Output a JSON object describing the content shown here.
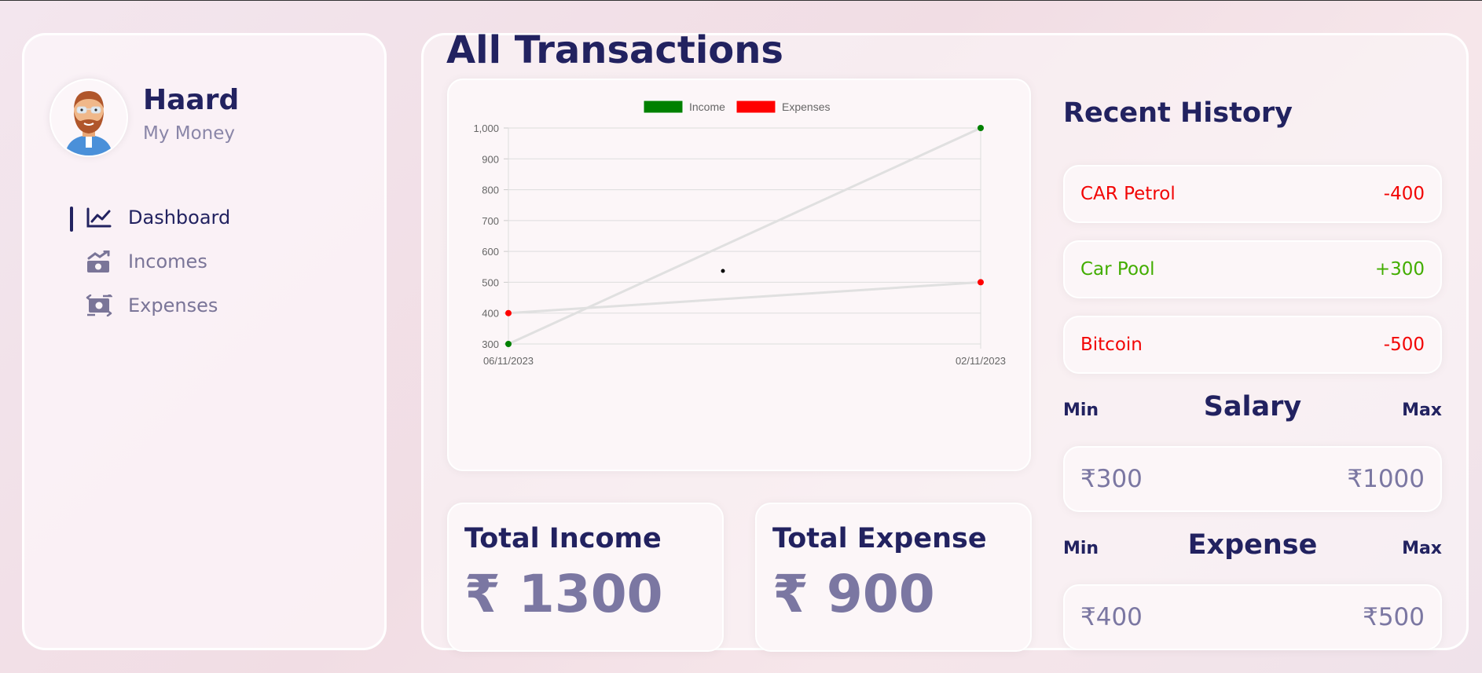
{
  "user": {
    "name": "Haard",
    "subtitle": "My Money"
  },
  "menu": [
    {
      "label": "Dashboard",
      "icon": "chart-line-icon",
      "active": true
    },
    {
      "label": "Incomes",
      "icon": "money-trend-icon",
      "active": false
    },
    {
      "label": "Expenses",
      "icon": "money-exchange-icon",
      "active": false
    }
  ],
  "main": {
    "title": "All Transactions",
    "total_income": {
      "label": "Total Income",
      "value": "₹ 1300"
    },
    "total_expense": {
      "label": "Total Expense",
      "value": "₹ 900"
    }
  },
  "chart_data": {
    "type": "line",
    "categories": [
      "06/11/2023",
      "02/11/2023"
    ],
    "series": [
      {
        "name": "Income",
        "values": [
          300,
          1000
        ],
        "color": "#008000"
      },
      {
        "name": "Expenses",
        "values": [
          400,
          500
        ],
        "color": "#ff0000"
      }
    ],
    "ylim": [
      300,
      1000
    ],
    "yticks": [
      "1,000",
      "900",
      "800",
      "700",
      "600",
      "500",
      "400",
      "300"
    ],
    "grid": true,
    "legend": "top-center"
  },
  "history": {
    "title": "Recent History",
    "items": [
      {
        "name": "CAR Petrol",
        "amount": "-400",
        "type": "expense",
        "color": "#f20505"
      },
      {
        "name": "Car Pool",
        "amount": "+300",
        "type": "income",
        "color": "#42ad00"
      },
      {
        "name": "Bitcoin",
        "amount": "-500",
        "type": "expense",
        "color": "#f20505"
      }
    ]
  },
  "salary": {
    "title": "Salary",
    "min_label": "Min",
    "max_label": "Max",
    "min": "₹300",
    "max": "₹1000"
  },
  "expense": {
    "title": "Expense",
    "min_label": "Min",
    "max_label": "Max",
    "min": "₹400",
    "max": "₹500"
  }
}
